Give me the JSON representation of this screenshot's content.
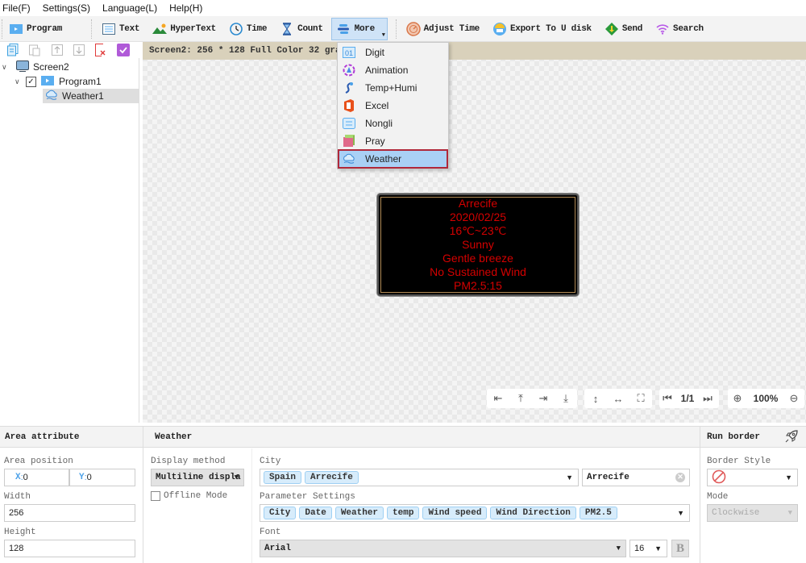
{
  "menubar": [
    "File(F)",
    "Settings(S)",
    "Language(L)",
    "Help(H)"
  ],
  "toolbar": {
    "program": "Program",
    "text": "Text",
    "hypertext": "HyperText",
    "time": "Time",
    "count": "Count",
    "more": "More",
    "adjust_time": "Adjust Time",
    "export": "Export To U disk",
    "send": "Send",
    "search": "Search"
  },
  "status": "Screen2: 256 * 128 Full Color 32 grayleve",
  "tree": {
    "screen": "Screen2",
    "program": "Program1",
    "weather": "Weather1"
  },
  "more_menu": [
    "Digit",
    "Animation",
    "Temp+Humi",
    "Excel",
    "Nongli",
    "Pray",
    "Weather"
  ],
  "led_preview": {
    "lines": [
      "Arrecife",
      "2020/02/25",
      "16℃~23℃",
      "Sunny",
      "Gentle breeze",
      "No Sustained Wind",
      "PM2.5:15"
    ],
    "color": "#d40000"
  },
  "canvas_controls": {
    "page": "1/1",
    "zoom": "100%"
  },
  "area": {
    "title": "Area attribute",
    "position_label": "Area position",
    "x_label": "X",
    "x": "0",
    "y_label": "Y",
    "y": "0",
    "width_label": "Width",
    "width": "256",
    "height_label": "Height",
    "height": "128"
  },
  "weather": {
    "title": "Weather",
    "display_method_label": "Display method",
    "display_method": "Multiline displa",
    "offline_label": "Offline Mode",
    "city_label": "City",
    "city_tags": [
      "Spain",
      "Arrecife"
    ],
    "city_value": "Arrecife",
    "param_label": "Parameter Settings",
    "params": [
      "City",
      "Date",
      "Weather",
      "temp",
      "Wind speed",
      "Wind Direction",
      "PM2.5"
    ],
    "font_label": "Font",
    "font": "Arial",
    "font_size": "16",
    "bold": "B"
  },
  "border": {
    "title": "Run border",
    "style_label": "Border Style",
    "mode_label": "Mode",
    "mode": "Clockwise"
  }
}
